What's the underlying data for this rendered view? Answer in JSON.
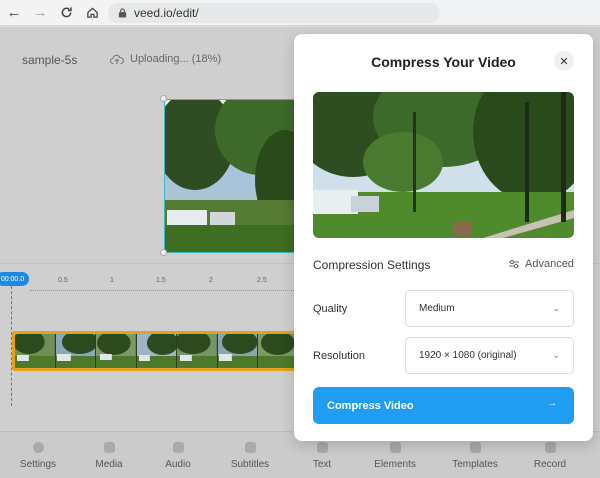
{
  "browser": {
    "url": "veed.io/edit/"
  },
  "editor": {
    "project_name": "sample-5s",
    "upload_status": "Uploading... (18%)",
    "upload_progress": 0.18,
    "playhead_time": "00:00.0",
    "ruler_ticks": [
      "0.5",
      "1",
      "1.5",
      "2",
      "2.5"
    ]
  },
  "toolbar": {
    "items": [
      {
        "label": "Settings",
        "icon": "gear-icon"
      },
      {
        "label": "Media",
        "icon": "plus-icon"
      },
      {
        "label": "Audio",
        "icon": "music-icon"
      },
      {
        "label": "Subtitles",
        "icon": "subtitles-icon"
      },
      {
        "label": "Text",
        "icon": "text-icon"
      },
      {
        "label": "Elements",
        "icon": "elements-icon"
      },
      {
        "label": "Templates",
        "icon": "templates-icon"
      },
      {
        "label": "Record",
        "icon": "record-icon"
      }
    ]
  },
  "modal": {
    "title": "Compress Your Video",
    "close_symbol": "✕",
    "section_title": "Compression Settings",
    "advanced_label": "Advanced",
    "quality_label": "Quality",
    "quality_value": "Medium",
    "resolution_label": "Resolution",
    "resolution_value": "1920 × 1080 (original)",
    "compress_button": "Compress Video",
    "accent_color": "#1e9df3"
  }
}
